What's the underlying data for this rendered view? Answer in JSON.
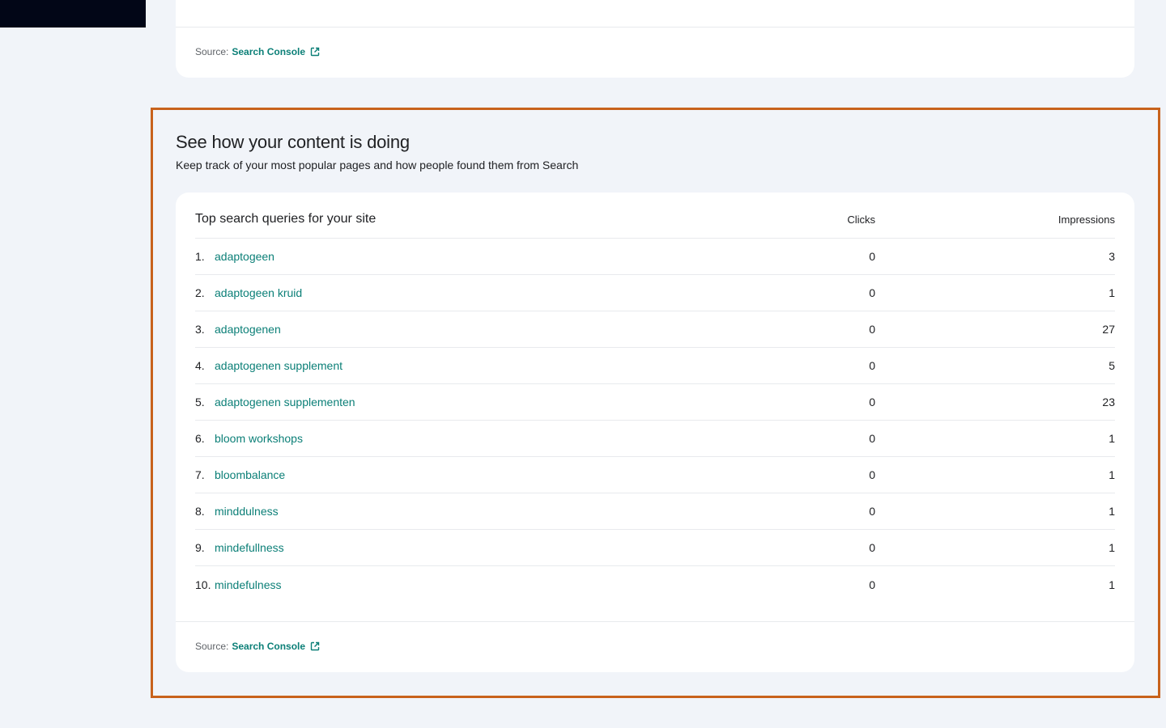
{
  "colors": {
    "accent": "#0b7f77",
    "highlight_border": "#c8621c",
    "page_background": "#f1f4f9"
  },
  "top_card": {
    "source_label": "Source:",
    "source_link": "Search Console",
    "source_icon": "external-link-icon"
  },
  "section": {
    "title": "See how your content is doing",
    "subtitle": "Keep track of your most popular pages and how people found them from Search"
  },
  "queries_table": {
    "title": "Top search queries for your site",
    "col_clicks": "Clicks",
    "col_impressions": "Impressions",
    "rows": [
      {
        "rank": "1.",
        "query": "adaptogeen",
        "clicks": "0",
        "impressions": "3"
      },
      {
        "rank": "2.",
        "query": "adaptogeen kruid",
        "clicks": "0",
        "impressions": "1"
      },
      {
        "rank": "3.",
        "query": "adaptogenen",
        "clicks": "0",
        "impressions": "27"
      },
      {
        "rank": "4.",
        "query": "adaptogenen supplement",
        "clicks": "0",
        "impressions": "5"
      },
      {
        "rank": "5.",
        "query": "adaptogenen supplementen",
        "clicks": "0",
        "impressions": "23"
      },
      {
        "rank": "6.",
        "query": "bloom workshops",
        "clicks": "0",
        "impressions": "1"
      },
      {
        "rank": "7.",
        "query": "bloombalance",
        "clicks": "0",
        "impressions": "1"
      },
      {
        "rank": "8.",
        "query": "minddulness",
        "clicks": "0",
        "impressions": "1"
      },
      {
        "rank": "9.",
        "query": "mindefullness",
        "clicks": "0",
        "impressions": "1"
      },
      {
        "rank": "10.",
        "query": "mindefulness",
        "clicks": "0",
        "impressions": "1"
      }
    ],
    "source_label": "Source:",
    "source_link": "Search Console",
    "source_icon": "external-link-icon"
  }
}
